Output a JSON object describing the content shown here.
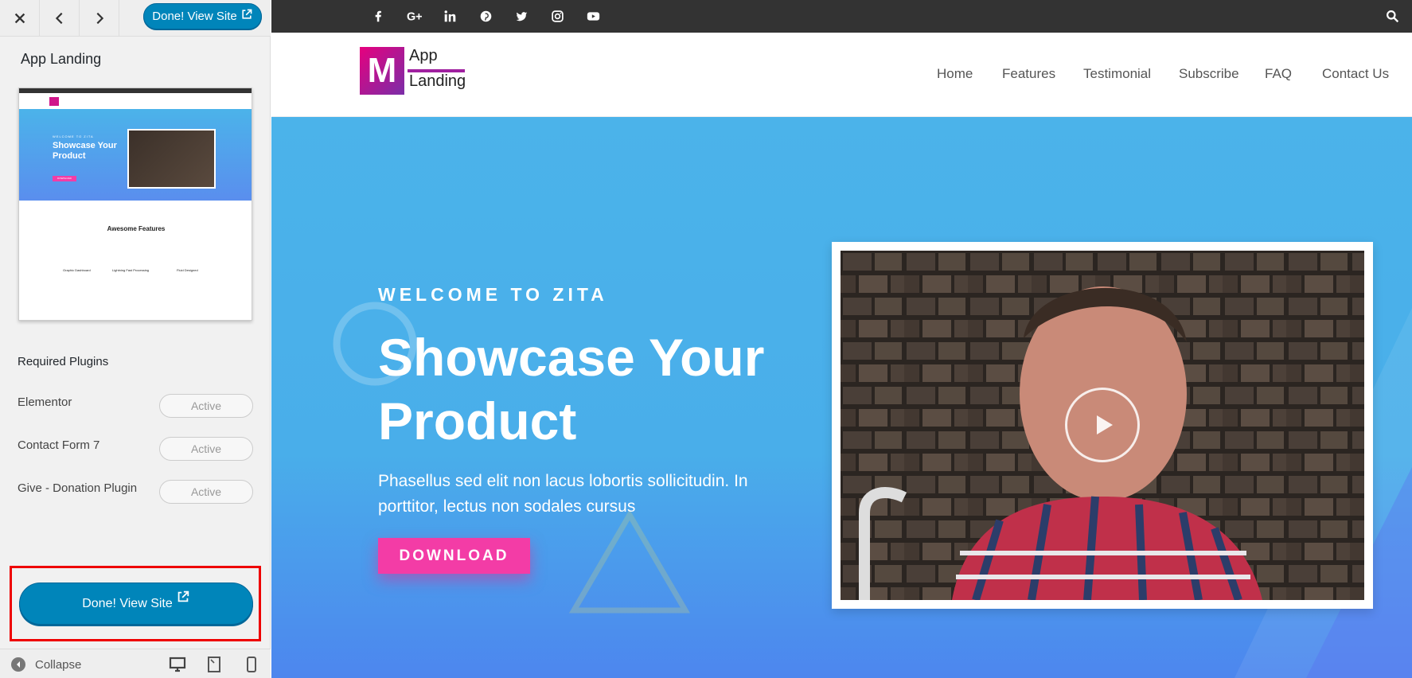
{
  "customizer": {
    "done_top_label": "Done! View Site",
    "theme_title": "App Landing",
    "required_plugins_title": "Required Plugins",
    "plugins": [
      {
        "name": "Elementor",
        "status": "Active"
      },
      {
        "name": "Contact Form 7",
        "status": "Active"
      },
      {
        "name": "Give - Donation Plugin",
        "status": "Active"
      }
    ],
    "done_big_label": "Done! View Site",
    "collapse_label": "Collapse",
    "thumbnail": {
      "kicker": "WELCOME TO ZITA",
      "heading": "Showcase Your Product",
      "features_title": "Awesome Features",
      "feature_1": "Graphic Dashboard",
      "feature_2": "Lightning Fast Processing",
      "feature_3": "Fluid Designed",
      "button": "DOWNLOAD"
    }
  },
  "preview": {
    "social_icons": [
      "facebook-icon",
      "google-plus-icon",
      "linkedin-icon",
      "pinterest-icon",
      "twitter-icon",
      "instagram-icon",
      "youtube-icon"
    ],
    "logo": {
      "letter": "M",
      "line1": "App",
      "line2": "Landing"
    },
    "nav": [
      "Home",
      "Features",
      "Testimonial",
      "Subscribe",
      "FAQ",
      "Contact Us"
    ],
    "hero": {
      "kicker": "WELCOME TO ZITA",
      "heading": "Showcase Your Product",
      "subtitle": "Phasellus sed elit non lacus lobortis sollicitudin. In porttitor, lectus non sodales cursus",
      "button": "DOWNLOAD"
    }
  },
  "colors": {
    "primary_button": "#0085ba",
    "hero_blue": "#4bb3ea",
    "download_pink": "#f33ca6",
    "highlight_border": "#ee0000"
  }
}
